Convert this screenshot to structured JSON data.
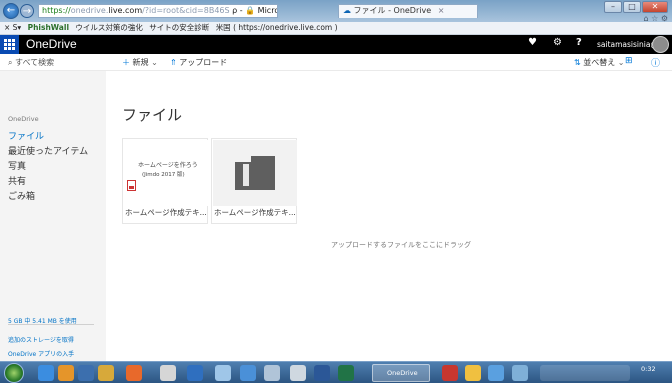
{
  "browser": {
    "address": {
      "scheme": "https://",
      "host_prefix": "onedrive.",
      "host": "live.com",
      "path": "/?id=root&cid=8B46S",
      "suffix": " ρ - 🔒 Microsoft Corporati... ¢"
    },
    "tab_inactive": {
      "label": "Microsoft Corporati..."
    },
    "tab_active": {
      "label": "ファイル - OneDrive",
      "close": "×"
    },
    "favorites": [
      {
        "label": "× S▾"
      },
      {
        "label": "PhishWall"
      },
      {
        "label": "ウイルス対策の強化"
      },
      {
        "label": "サイトの安全診断"
      },
      {
        "label": "米国 ( https://onedrive.live.com )"
      }
    ],
    "window_buttons": {
      "minimize": "–",
      "maximize": "□",
      "close": "✕"
    }
  },
  "suitebar": {
    "brand": "OneDrive",
    "user_name": "saitamasisinia@y..."
  },
  "commandbar": {
    "search_placeholder": "すべて検索",
    "new_label": "新規",
    "upload_label": "アップロード",
    "sort_label": "並べ替え"
  },
  "leftnav": {
    "header": "OneDrive",
    "items": [
      {
        "label": "ファイル"
      },
      {
        "label": "最近使ったアイテム"
      },
      {
        "label": "写真"
      },
      {
        "label": "共有"
      },
      {
        "label": "ごみ箱"
      }
    ],
    "storage_used": "5 GB 中 5.41 MB を使用",
    "get_more_storage": "追加のストレージを取得",
    "get_apps": "OneDrive アプリの入手"
  },
  "main": {
    "title": "ファイル",
    "files": [
      {
        "name": "ホームページ作成テキ...",
        "thumb_line1": "ホームページを作ろう",
        "thumb_line2": "(Jimdo 2017 版)"
      },
      {
        "name": "ホームページ作成テキ..."
      }
    ],
    "drop_hint": "アップロードするファイルをここにドラッグ"
  },
  "taskbar": {
    "active_app": "OneDrive",
    "time": "0:32"
  }
}
